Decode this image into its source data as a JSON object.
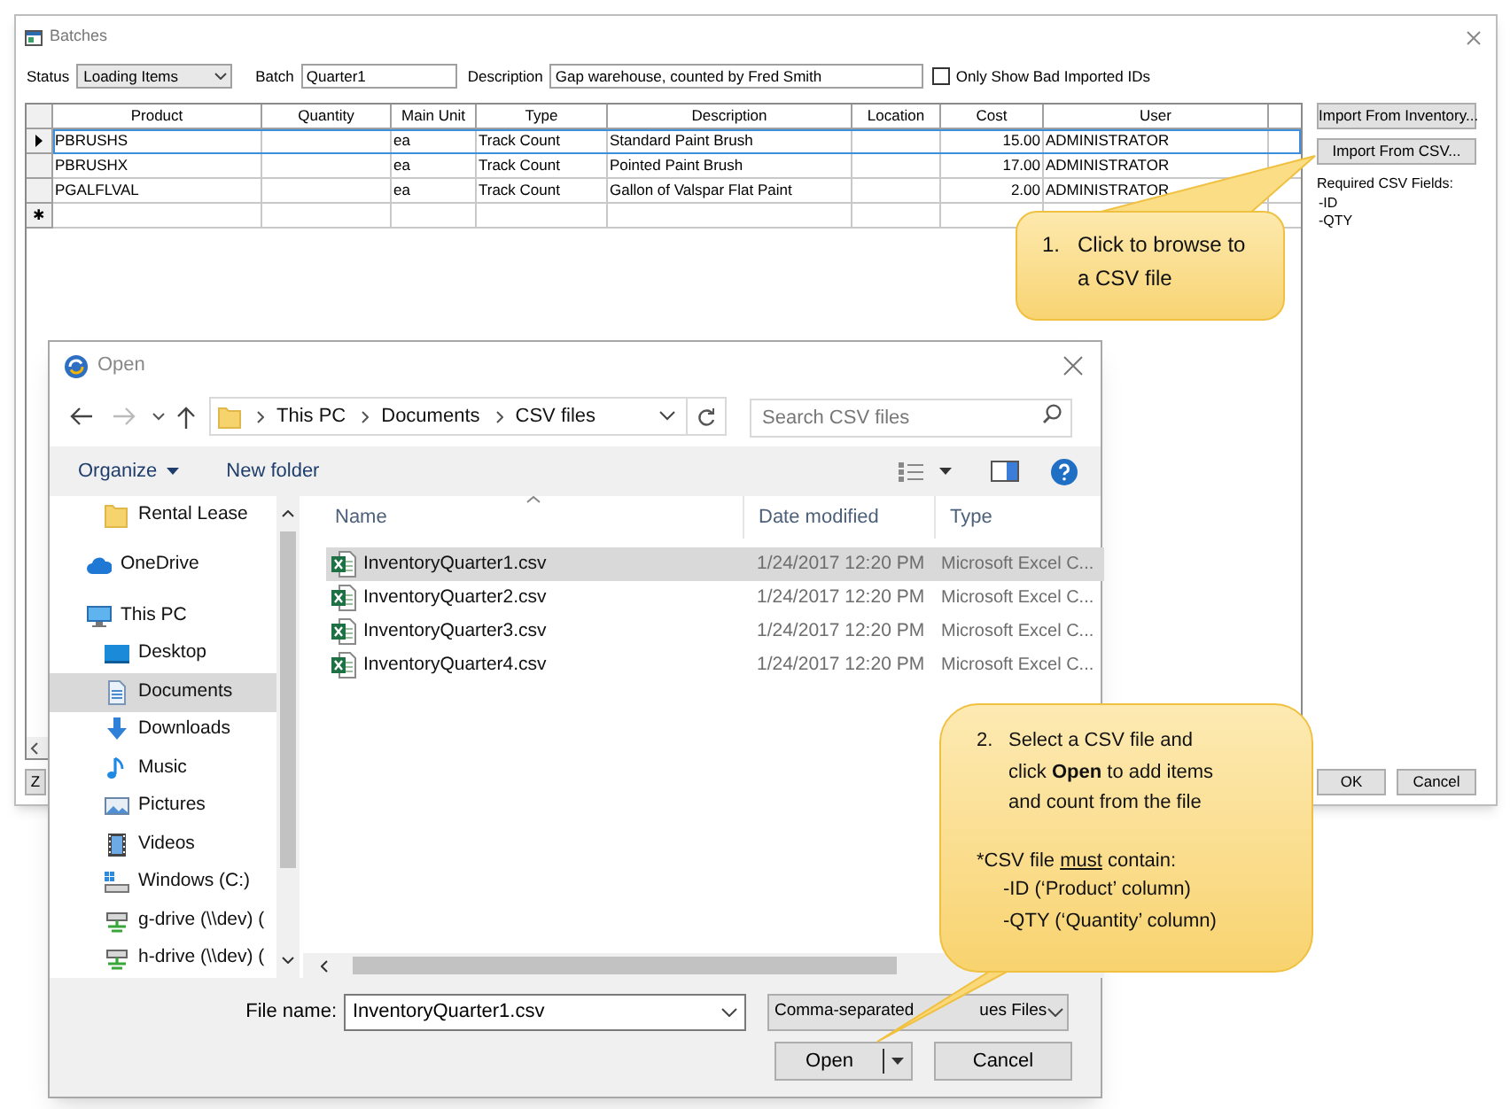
{
  "batches_window": {
    "title": "Batches",
    "status": {
      "label": "Status",
      "value": "Loading Items"
    },
    "batch": {
      "label": "Batch",
      "value": "Quarter1"
    },
    "description": {
      "label": "Description",
      "value": "Gap warehouse, counted by Fred Smith"
    },
    "bad_ids_filter": {
      "label": "Only Show Bad Imported IDs",
      "checked": false
    },
    "table": {
      "columns": [
        "Product",
        "Quantity",
        "Main Unit",
        "Type",
        "Description",
        "Location",
        "Cost",
        "User"
      ],
      "rows": [
        {
          "product": "PBRUSHS",
          "main_unit": "ea",
          "type": "Track Count",
          "description": "Standard Paint Brush",
          "cost": "15.00",
          "user": "ADMINISTRATOR",
          "selected": true
        },
        {
          "product": "PBRUSHX",
          "main_unit": "ea",
          "type": "Track Count",
          "description": "Pointed Paint Brush",
          "cost": "17.00",
          "user": "ADMINISTRATOR",
          "selected": false
        },
        {
          "product": "PGALFLVAL",
          "main_unit": "ea",
          "type": "Track Count",
          "description": "Gallon of Valspar Flat Paint",
          "cost": "2.00",
          "user": "ADMINISTRATOR",
          "selected": false
        }
      ],
      "new_row_marker": "✱"
    },
    "side_buttons": [
      "Import From Inventory...",
      "Import From CSV..."
    ],
    "required_fields": {
      "title": "Required CSV Fields:",
      "items": [
        "-ID",
        "-QTY"
      ]
    },
    "footer_left_buttons": [
      "Z"
    ],
    "footer_buttons": [
      "OK",
      "Cancel"
    ]
  },
  "open_dialog": {
    "title": "Open",
    "breadcrumb": [
      "This PC",
      "Documents",
      "CSV files"
    ],
    "search": {
      "placeholder": "Search CSV files"
    },
    "toolbar": {
      "organize": "Organize",
      "new_folder": "New folder"
    },
    "nav_pane": {
      "quick_access": [
        {
          "label": "Rental Lease",
          "kind": "folder",
          "selected": false
        }
      ],
      "items": [
        {
          "label": "OneDrive",
          "kind": "cloud",
          "selected": false
        },
        {
          "label": "This PC",
          "kind": "computer",
          "selected": false,
          "children": [
            {
              "label": "Desktop",
              "kind": "desktop",
              "selected": false
            },
            {
              "label": "Documents",
              "kind": "documents",
              "selected": true
            },
            {
              "label": "Downloads",
              "kind": "download",
              "selected": false
            },
            {
              "label": "Music",
              "kind": "music",
              "selected": false
            },
            {
              "label": "Pictures",
              "kind": "pictures",
              "selected": false
            },
            {
              "label": "Videos",
              "kind": "videos",
              "selected": false
            },
            {
              "label": "Windows (C:)",
              "kind": "drive",
              "selected": false
            },
            {
              "label": "g-drive (\\\\dev) (",
              "kind": "network-drive",
              "selected": false
            },
            {
              "label": "h-drive (\\\\dev) (",
              "kind": "network-drive",
              "selected": false
            }
          ]
        }
      ]
    },
    "columns": [
      "Name",
      "Date modified",
      "Type"
    ],
    "files": [
      {
        "name": "InventoryQuarter1.csv",
        "date": "1/24/2017 12:20 PM",
        "type": "Microsoft Excel C...",
        "selected": true
      },
      {
        "name": "InventoryQuarter2.csv",
        "date": "1/24/2017 12:20 PM",
        "type": "Microsoft Excel C...",
        "selected": false
      },
      {
        "name": "InventoryQuarter3.csv",
        "date": "1/24/2017 12:20 PM",
        "type": "Microsoft Excel C...",
        "selected": false
      },
      {
        "name": "InventoryQuarter4.csv",
        "date": "1/24/2017 12:20 PM",
        "type": "Microsoft Excel C...",
        "selected": false
      }
    ],
    "file_name": {
      "label": "File name:",
      "value": "InventoryQuarter1.csv"
    },
    "file_type": {
      "visible_start": "Comma-separated",
      "visible_end": "ues Files"
    },
    "buttons": {
      "open": "Open",
      "cancel": "Cancel"
    }
  },
  "callouts": [
    {
      "number": "1.",
      "text": "Click to browse to a CSV file"
    },
    {
      "number": "2.",
      "text": "Select a CSV file and click **Open** to add items and count from the file",
      "note": {
        "before": "*CSV file",
        "underlined": "must",
        "after": "contain:"
      },
      "requirements": [
        "-ID (‘Product’ column)",
        "-QTY (‘Quantity’ column)"
      ]
    }
  ]
}
